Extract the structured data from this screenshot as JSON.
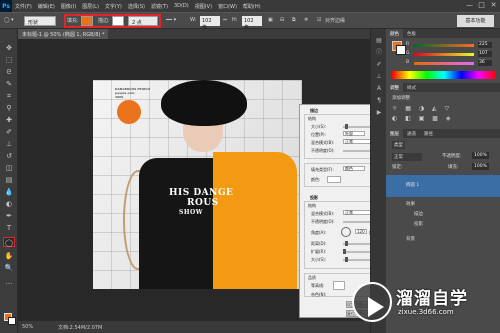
{
  "app": {
    "logo": "Ps"
  },
  "menu": [
    "文件(F)",
    "编辑(E)",
    "图像(I)",
    "图层(L)",
    "文字(Y)",
    "选择(S)",
    "滤镜(T)",
    "3D(D)",
    "视图(V)",
    "窗口(W)",
    "帮助(H)"
  ],
  "window_controls": [
    "—",
    "□",
    "✕"
  ],
  "options": {
    "mode": "形状",
    "fill_label": "填充:",
    "fill_color": "#e8731c",
    "stroke_label": "描边:",
    "stroke_color": "#ffffff",
    "stroke_width": "2 点",
    "w_label": "W:",
    "w_value": "102 像",
    "h_label": "H:",
    "h_value": "102 像",
    "align_edges": "对齐边缘",
    "workspace": "基本功能"
  },
  "document": {
    "tab_title": "未标题-1 @ 50% (椭圆 1, RGB/8) *",
    "watermark_lines": [
      "DANGEROUS PEOPLE",
      "people.com",
      "3000"
    ],
    "shirt_text": [
      "HIS DANGE",
      "ROUS",
      "SHOW"
    ]
  },
  "layer_style_dialog": {
    "section_title": "描边",
    "structure": "结构",
    "size_label": "大小(S):",
    "size_value": "6",
    "size_unit": "像素",
    "position_label": "位置(P):",
    "position_value": "外部",
    "blend_label": "混合模式(B):",
    "blend_value": "正常",
    "opacity_label": "不透明度(O):",
    "opacity_value": "100",
    "opacity_unit": "%",
    "fill_type_label": "填充类型(F):",
    "fill_type_value": "颜色",
    "color_label": "颜色:",
    "shadow_title": "投影",
    "shadow_structure": "结构",
    "shadow_blend_label": "混合模式(B):",
    "shadow_blend_value": "正常",
    "shadow_opacity_label": "不透明度(O):",
    "shadow_opacity_value": "75",
    "angle_label": "角度(A):",
    "angle_value": "120",
    "global_light": "使用全局光(G)",
    "distance_label": "距离(D):",
    "distance_value": "4",
    "spread_label": "扩展(R):",
    "spread_value": "0",
    "size2_label": "大小(S):",
    "size2_value": "4",
    "quality_title": "品质",
    "contour_label": "等高线:",
    "noise_label": "杂色(N):",
    "buttons": [
      "设置为默认值",
      "复位为默认值"
    ],
    "unit_px": "像素",
    "unit_deg": "度",
    "unit_pct": "%"
  },
  "panels": {
    "color_tabs": [
      "颜色",
      "色板"
    ],
    "color_rows": [
      {
        "label": "R",
        "value": "225"
      },
      {
        "label": "G",
        "value": "107"
      },
      {
        "label": "B",
        "value": "36"
      }
    ],
    "adjust_tabs": [
      "调整",
      "样式"
    ],
    "adjust_title": "添加调整",
    "layer_tabs": [
      "图层",
      "通道",
      "路径"
    ],
    "layer_kind": "类型",
    "layer_mode": "正常",
    "opacity_label": "不透明度:",
    "opacity_value": "100%",
    "lock_label": "锁定:",
    "fill_label": "填充:",
    "fill_value": "100%",
    "layers": [
      "椭圆 1",
      "效果",
      "描边",
      "投影",
      "背景"
    ]
  },
  "status": {
    "zoom": "50%",
    "doc_info": "文档:2.54M/2.07M"
  },
  "watermark": {
    "title": "溜溜自学",
    "url": "zixue.3d66.com"
  }
}
